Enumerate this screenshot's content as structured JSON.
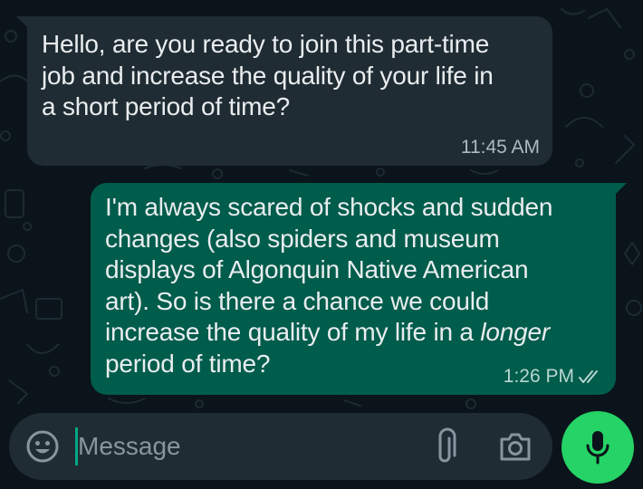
{
  "conversation": {
    "incoming": {
      "text": "Hello, are you ready to join this part-time\njob and increase the quality of your life in\na short period of time?",
      "time": "11:45 AM"
    },
    "outgoing": {
      "text_part1": "I'm always scared of shocks and sudden\nchanges (also spiders and museum\ndisplays of Algonquin Native American\nart).  So is there a chance we could\nincrease the quality of my life in a ",
      "text_emphasis": "longer",
      "text_part2": "\nperiod of time?",
      "time": "1:26 PM",
      "status_icon": "double-check-icon"
    }
  },
  "composer": {
    "placeholder": "Message",
    "value": "",
    "emoji_icon": "emoji-icon",
    "attach_icon": "paperclip-icon",
    "camera_icon": "camera-icon",
    "send_icon": "microphone-icon"
  },
  "colors": {
    "background": "#0b141a",
    "incoming_bubble": "#202c33",
    "outgoing_bubble": "#005c4b",
    "accent": "#25d366",
    "caret": "#00a884"
  }
}
